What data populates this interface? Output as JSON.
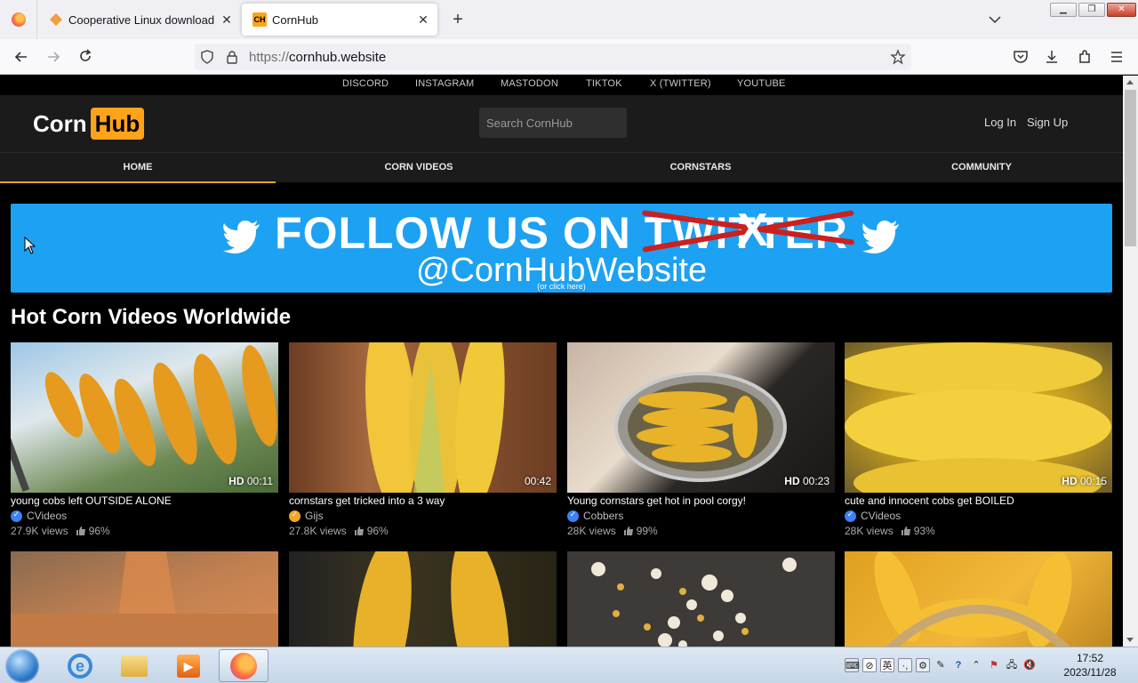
{
  "browser": {
    "tabs": [
      {
        "title": "Cooperative Linux download"
      },
      {
        "title": "CornHub"
      }
    ],
    "url_protocol": "https://",
    "url_host": "cornhub.website"
  },
  "site": {
    "social_links": [
      "DISCORD",
      "INSTAGRAM",
      "MASTODON",
      "TIKTOK",
      "X (TWITTER)",
      "YOUTUBE"
    ],
    "logo_part1": "Corn",
    "logo_part2": "Hub",
    "search_placeholder": "Search CornHub",
    "login": "Log In",
    "signup": "Sign Up",
    "nav": [
      "HOME",
      "CORN VIDEOS",
      "CORNSTARS",
      "COMMUNITY"
    ],
    "banner": {
      "follow": "FOLLOW US ON",
      "struck": "TWITTER",
      "x_letter": "X",
      "handle": "@CornHubWebsite",
      "hint": "(or click here)"
    },
    "section_title": "Hot Corn Videos Worldwide",
    "videos": [
      {
        "hd": "HD",
        "duration": "00:11",
        "title": "young cobs left OUTSIDE ALONE",
        "channel": "CVideos",
        "badge_color": "#3b82f6",
        "views": "27.9K views",
        "rating": "96%"
      },
      {
        "hd": "",
        "duration": "00:42",
        "title": "cornstars get tricked into a 3 way",
        "channel": "Gijs",
        "badge_color": "#f5a623",
        "views": "27.8K views",
        "rating": "96%"
      },
      {
        "hd": "HD",
        "duration": "00:23",
        "title": "Young cornstars get hot in pool corgy!",
        "channel": "Cobbers",
        "badge_color": "#3b82f6",
        "views": "28K views",
        "rating": "99%"
      },
      {
        "hd": "HD",
        "duration": "00:15",
        "title": "cute and innocent cobs get BOILED",
        "channel": "CVideos",
        "badge_color": "#3b82f6",
        "views": "28K views",
        "rating": "93%"
      }
    ]
  },
  "taskbar": {
    "time": "17:52",
    "date": "2023/11/28",
    "ime": "英"
  }
}
